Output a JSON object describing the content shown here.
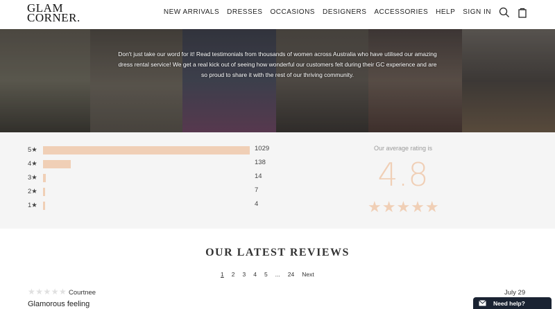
{
  "header": {
    "logo_line1": "GLAM",
    "logo_line2": "CORNER.",
    "nav": [
      "NEW ARRIVALS",
      "DRESSES",
      "OCCASIONS",
      "DESIGNERS",
      "ACCESSORIES",
      "HELP",
      "SIGN IN"
    ],
    "icons": [
      "search-icon",
      "shopping-bag-icon"
    ]
  },
  "hero": {
    "text": "Don't just take our word for it! Read testimonials from thousands of women across Australia who have utilised our amazing dress rental service! We get a real kick out of seeing how wonderful our customers felt during their GC experience and are so proud to share it with the rest of our thriving community."
  },
  "ratings": {
    "rows": [
      {
        "label": "5★",
        "count": "1029",
        "fraction": 1.0
      },
      {
        "label": "4★",
        "count": "138",
        "fraction": 0.134
      },
      {
        "label": "3★",
        "count": "14",
        "fraction": 0.014
      },
      {
        "label": "2★",
        "count": "7",
        "fraction": 0.007
      },
      {
        "label": "1★",
        "count": "4",
        "fraction": 0.004
      }
    ],
    "avg_label": "Our average rating is",
    "avg_value": "4.8",
    "avg_stars": "★★★★★",
    "bar_color": "#f0cfb6"
  },
  "reviews": {
    "title": "OUR LATEST REVIEWS",
    "pages": [
      "1",
      "2",
      "3",
      "4",
      "5",
      "...",
      "24",
      "Next"
    ],
    "active_page": "1",
    "first_review": {
      "stars": "★★★★★",
      "name": "Courtnee",
      "date": "July 29",
      "title": "Glamorous feeling"
    }
  },
  "help": {
    "label": "Need help?",
    "icon": "mail-icon",
    "color": "#1a2332"
  }
}
